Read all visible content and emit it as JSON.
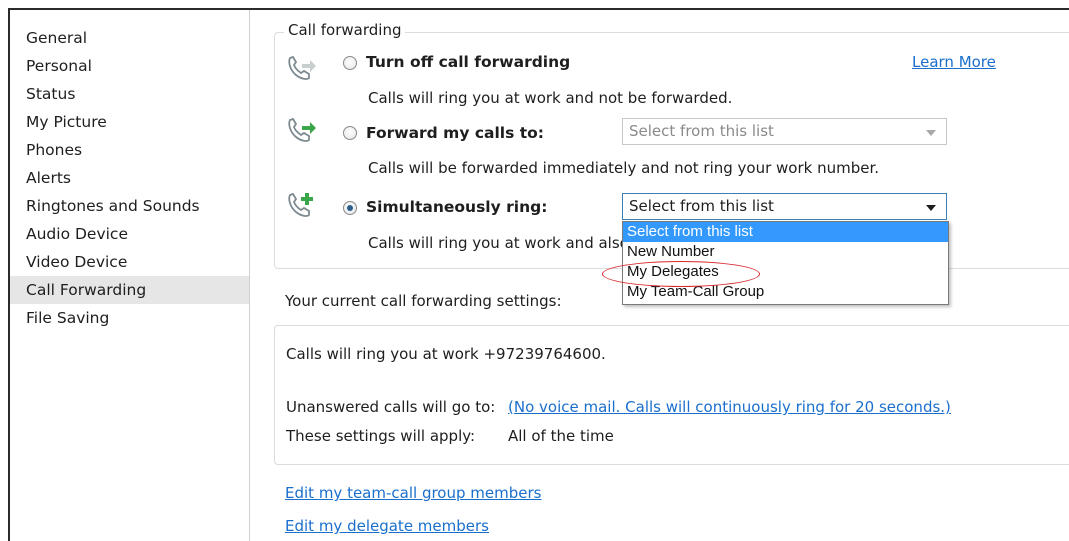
{
  "sidebar": {
    "items": [
      "General",
      "Personal",
      "Status",
      "My Picture",
      "Phones",
      "Alerts",
      "Ringtones and Sounds",
      "Audio Device",
      "Video Device",
      "Call Forwarding",
      "File Saving"
    ],
    "selected": "Call Forwarding"
  },
  "call_forwarding": {
    "group_title": "Call forwarding",
    "learn_more": "Learn More",
    "options": [
      {
        "label": "Turn off call forwarding",
        "description": "Calls will ring you at work and not be forwarded.",
        "checked": false
      },
      {
        "label": "Forward my calls to:",
        "description": "Calls will be forwarded immediately and not ring your work number.",
        "checked": false,
        "select_value": "Select from this list"
      },
      {
        "label": "Simultaneously ring:",
        "description": "Calls will ring you at work and also",
        "checked": true,
        "select_value": "Select from this list"
      }
    ],
    "dropdown_options": [
      "Select from this list",
      "New Number",
      "My Delegates",
      "My Team-Call Group"
    ],
    "dropdown_highlighted": "Select from this list"
  },
  "current_settings": {
    "label": "Your current call forwarding settings:",
    "ring_text": "Calls will ring you at work +97239764600.",
    "unanswered_label": "Unanswered calls will go to:",
    "unanswered_link": "(No voice mail. Calls will continuously ring for 20 seconds.)",
    "apply_label": "These settings will apply:",
    "apply_value": "All of the time"
  },
  "links": {
    "team_call": "Edit my team-call group members",
    "delegates": "Edit my delegate members"
  },
  "colors": {
    "link": "#1a6fcd",
    "highlight": "#3399ff",
    "phone_icon": "#7d8a8f",
    "arrow_green": "#3aa64a",
    "annotation": "#d9262b"
  },
  "icons": [
    "phone-forward-icon",
    "phone-forward-active-icon",
    "phone-add-icon"
  ]
}
